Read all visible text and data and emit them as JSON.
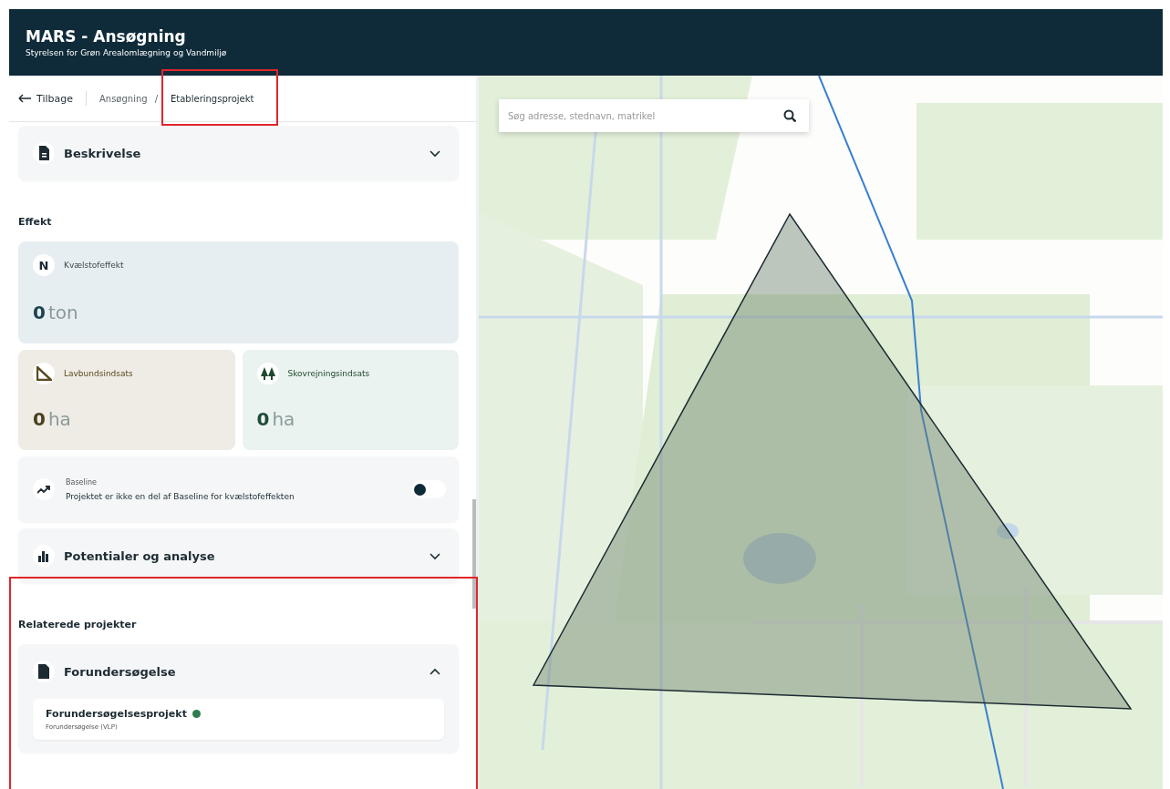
{
  "header": {
    "title": "MARS - Ansøgning",
    "subtitle": "Styrelsen for Grøn Arealomlægning og Vandmiljø"
  },
  "nav": {
    "back": "Tilbage",
    "breadcrumbs": [
      "Ansøgning",
      "/",
      "Etableringsprojekt"
    ]
  },
  "sections": [
    {
      "kind": "accordion",
      "title": "Beskrivelse",
      "expanded": false
    },
    {
      "kind": "heading",
      "title": "Effekt"
    },
    {
      "kind": "stat",
      "badge": "N",
      "label": "Kvælstofeffekt",
      "value": "0",
      "unit": "ton"
    },
    {
      "kind": "stat-pair",
      "items": [
        {
          "label": "Lavbundsindsats",
          "value": "0",
          "unit": "ha"
        },
        {
          "label": "Skovrejningsindsats",
          "value": "0",
          "unit": "ha"
        }
      ]
    },
    {
      "kind": "toggle",
      "label": "Baseline",
      "text": "Projektet er ikke en del af Baseline for kvælstofeffekten",
      "on": false
    },
    {
      "kind": "accordion",
      "title": "Potentialer og analyse",
      "expanded": false
    },
    {
      "kind": "heading",
      "title": "Relaterede projekter"
    },
    {
      "kind": "accordion",
      "title": "Forundersøgelse",
      "expanded": true,
      "items": [
        {
          "title": "Forundersøgelsesprojekt",
          "subtitle": "Forundersøgelse (VLP)",
          "color": "#2e7d4f"
        }
      ]
    }
  ],
  "map": {
    "search": {
      "placeholder": "Søg adresse, stednavn, matrikel"
    }
  }
}
